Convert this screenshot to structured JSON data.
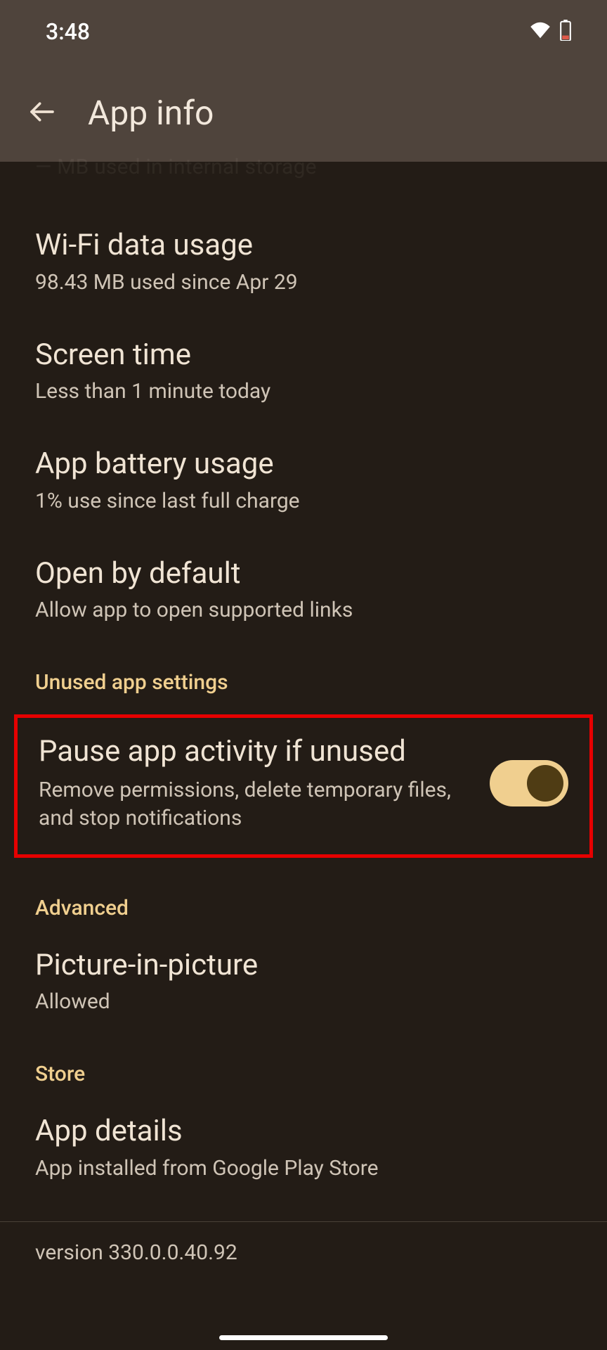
{
  "status": {
    "time": "3:48"
  },
  "appbar": {
    "title": "App info"
  },
  "rows": {
    "storage_cutoff": "— MB used in internal storage",
    "wifi": {
      "title": "Wi-Fi data usage",
      "sub": "98.43 MB used since Apr 29"
    },
    "screen_time": {
      "title": "Screen time",
      "sub": "Less than 1 minute today"
    },
    "battery": {
      "title": "App battery usage",
      "sub": "1% use since last full charge"
    },
    "open_default": {
      "title": "Open by default",
      "sub": "Allow app to open supported links"
    },
    "pause": {
      "title": "Pause app activity if unused",
      "sub": "Remove permissions, delete temporary files, and stop notifications",
      "enabled": true
    },
    "pip": {
      "title": "Picture-in-picture",
      "sub": "Allowed"
    },
    "app_details": {
      "title": "App details",
      "sub": "App installed from Google Play Store"
    }
  },
  "sections": {
    "unused": "Unused app settings",
    "advanced": "Advanced",
    "store": "Store"
  },
  "version": "version 330.0.0.40.92"
}
